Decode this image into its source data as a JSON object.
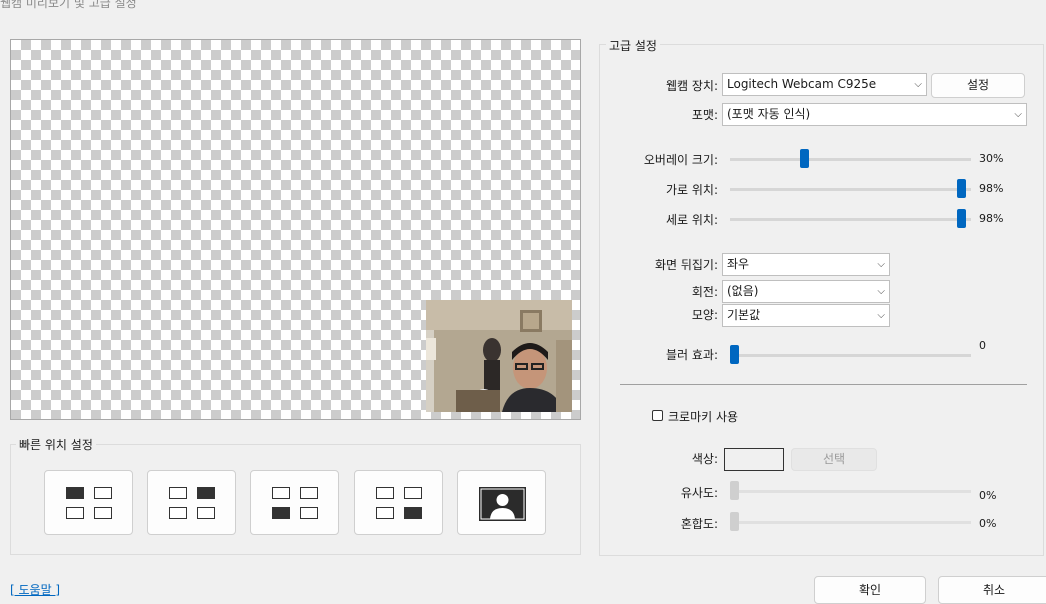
{
  "window": {
    "title": "웹캠 미리보기 및 고급 설정"
  },
  "quick": {
    "title": "빠른 위치 설정"
  },
  "advanced": {
    "title": "고급 설정",
    "device_label": "웹캠 장치:",
    "device_value": "Logitech Webcam C925e",
    "settings_button": "설정",
    "format_label": "포맷:",
    "format_value": "(포맷 자동 인식)",
    "overlay_label": "오버레이 크기:",
    "overlay_value": "30%",
    "overlay_level": 30,
    "hpos_label": "가로 위치:",
    "hpos_value": "98%",
    "hpos_level": 98,
    "vpos_label": "세로 위치:",
    "vpos_value": "98%",
    "vpos_level": 98,
    "flip_label": "화면 뒤집기:",
    "flip_value": "좌우",
    "rotate_label": "회전:",
    "rotate_value": "(없음)",
    "shape_label": "모양:",
    "shape_value": "기본값",
    "blur_label": "블러 효과:",
    "blur_value": "0",
    "blur_level": 0,
    "chroma_label": "크로마키 사용",
    "chroma_checked": false,
    "color_label": "색상:",
    "color_select_button": "선택",
    "similarity_label": "유사도:",
    "similarity_value": "0%",
    "blend_label": "혼합도:",
    "blend_value": "0%"
  },
  "footer": {
    "help_link": "[ 도움말 ]",
    "ok_button": "확인",
    "cancel_button": "취소"
  },
  "colors": {
    "accent": "#0067c0",
    "background": "#f0f0f0"
  },
  "icons": {
    "dropdown": "chevron-down-icon",
    "person": "person-icon"
  }
}
